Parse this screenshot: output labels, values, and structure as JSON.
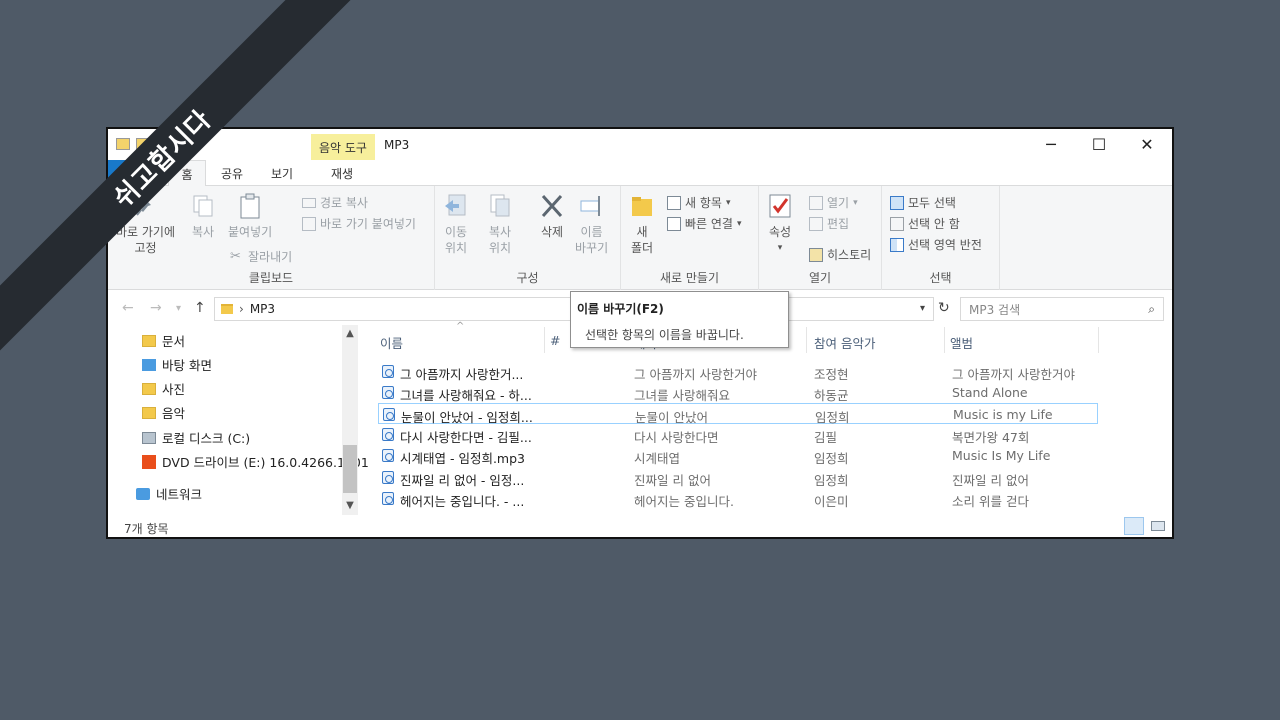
{
  "banner": {
    "text": "쉬고합시다"
  },
  "window": {
    "title": "MP3",
    "context_tab": "음악 도구",
    "controls": {
      "minimize": "─",
      "maximize": "☐",
      "close": "✕"
    }
  },
  "tabs": {
    "file": "파일",
    "home": "홈",
    "share": "공유",
    "view": "보기",
    "play": "재생"
  },
  "ribbon": {
    "collapse": "^",
    "help": "?",
    "clipboard": {
      "label": "클립보드",
      "pin_line1": "바로 가기에",
      "pin_line2": "고정",
      "copy": "복사",
      "paste": "붙여넣기",
      "copy_path": "경로 복사",
      "paste_shortcut": "바로 가기 붙여넣기",
      "cut": "잘라내기"
    },
    "organize": {
      "label": "구성",
      "move_line1": "이동",
      "move_line2": "위치",
      "copyto_line1": "복사",
      "copyto_line2": "위치",
      "delete": "삭제",
      "rename_line1": "이름",
      "rename_line2": "바꾸기"
    },
    "new": {
      "label": "새로 만들기",
      "folder_line1": "새",
      "folder_line2": "폴더",
      "new_item": "새 항목",
      "easy_access": "빠른 연결"
    },
    "open": {
      "label": "열기",
      "properties": "속성",
      "open": "열기",
      "edit": "편집",
      "history": "히스토리"
    },
    "select": {
      "label": "선택",
      "select_all": "모두 선택",
      "select_none": "선택 안 함",
      "invert": "선택 영역 반전"
    }
  },
  "address": {
    "path": "MP3",
    "search_placeholder": "MP3 검색"
  },
  "nav": {
    "items": [
      {
        "label": "문서"
      },
      {
        "label": "바탕 화면"
      },
      {
        "label": "사진"
      },
      {
        "label": "음악"
      },
      {
        "label": "로컬 디스크 (C:)"
      },
      {
        "label": "DVD 드라이브 (E:) 16.0.4266.1001"
      },
      {
        "label": "네트워크"
      }
    ]
  },
  "columns": {
    "name": "이름",
    "number": "#",
    "title": "제목",
    "artist": "참여 음악가",
    "album": "앨범"
  },
  "files": [
    {
      "name": "그 아픔까지 사랑한거...",
      "title": "그 아픔까지 사랑한거야",
      "artist": "조정현",
      "album": "그 아픔까지 사랑한거야"
    },
    {
      "name": "그녀를 사랑해줘요 - 하...",
      "title": "그녀를 사랑해줘요",
      "artist": "하동균",
      "album": "Stand Alone"
    },
    {
      "name": "눈물이 안났어 - 임정희...",
      "title": "눈물이 안났어",
      "artist": "임정희",
      "album": "Music is my Life"
    },
    {
      "name": "다시 사랑한다면 - 김필...",
      "title": "다시 사랑한다면",
      "artist": "김필",
      "album": "복면가왕 47회"
    },
    {
      "name": "시계태엽 - 임정희.mp3",
      "title": "시계태엽",
      "artist": "임정희",
      "album": "Music Is My Life"
    },
    {
      "name": "진짜일 리 없어 - 임정...",
      "title": "진짜일 리 없어",
      "artist": "임정희",
      "album": "진짜일 리 없어"
    },
    {
      "name": "헤어지는 중입니다. - ...",
      "title": "헤어지는 중입니다.",
      "artist": "이은미",
      "album": "소리 위를 걷다"
    }
  ],
  "status": {
    "count": "7개 항목"
  },
  "tooltip": {
    "title": "이름 바꾸기(F2)",
    "body": "선택한 항목의 이름을 바꿉니다."
  }
}
